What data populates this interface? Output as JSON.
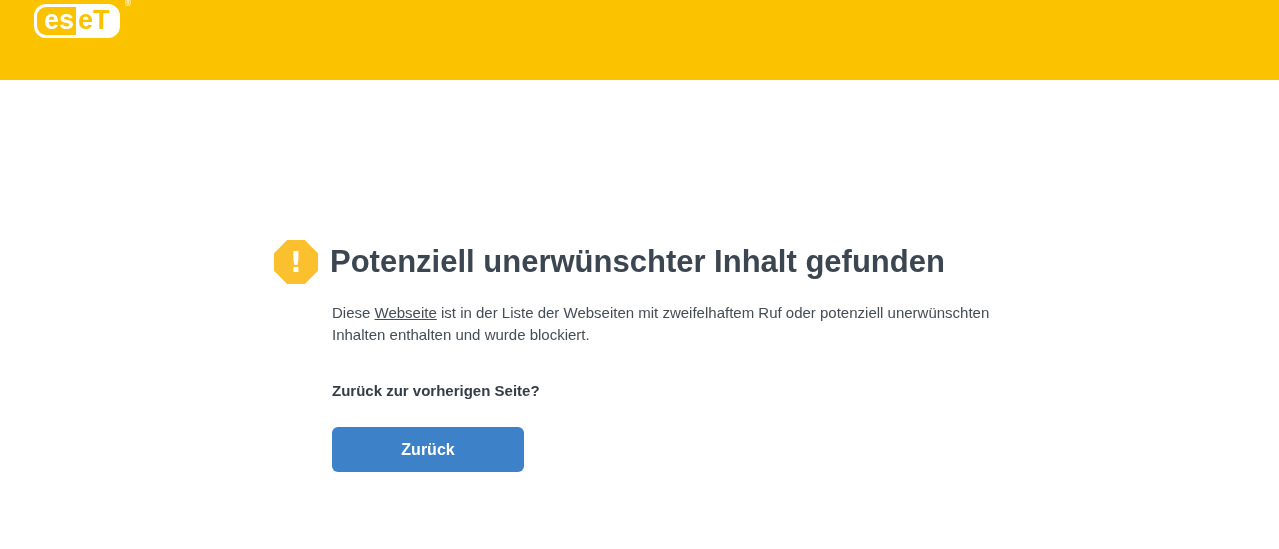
{
  "logo": {
    "left": "es",
    "right": "eT",
    "mark": "®"
  },
  "heading": "Potenziell unerwünschter Inhalt gefunden",
  "message": {
    "before": "Diese ",
    "link": "Webseite",
    "after": " ist in der Liste der Webseiten mit zweifelhaftem Ruf oder potenziell unerwünschten Inhalten enthalten und wurde blockiert."
  },
  "question": "Zurück zur vorherigen Seite?",
  "icon_glyph": "!",
  "button": "Zurück"
}
